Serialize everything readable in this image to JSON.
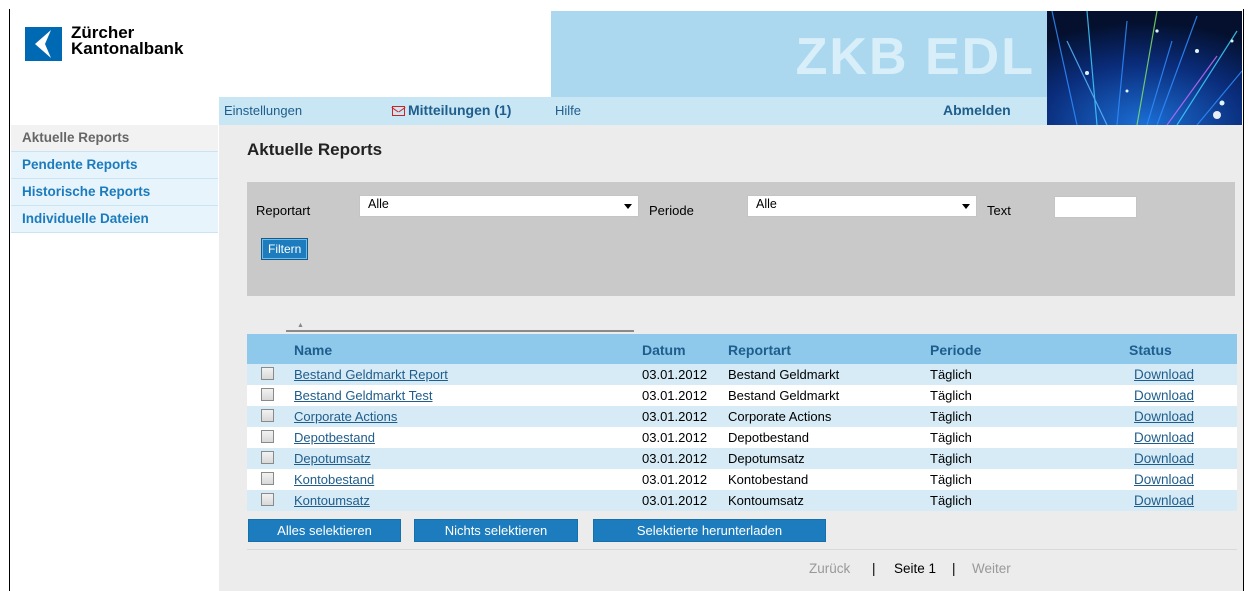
{
  "brand": {
    "name_line1": "Zürcher",
    "name_line2": "Kantonalbank",
    "banner_title": "ZKB EDL"
  },
  "topnav": {
    "settings": "Einstellungen",
    "messages": "Mitteilungen (1)",
    "help": "Hilfe",
    "logout": "Abmelden"
  },
  "sidebar": {
    "items": [
      {
        "label": "Aktuelle Reports",
        "active": true
      },
      {
        "label": "Pendente Reports"
      },
      {
        "label": "Historische Reports"
      },
      {
        "label": "Individuelle Dateien"
      }
    ]
  },
  "page": {
    "title": "Aktuelle Reports"
  },
  "filter": {
    "report_type_label": "Reportart",
    "report_type_value": "Alle",
    "period_label": "Periode",
    "period_value": "Alle",
    "text_label": "Text",
    "text_value": "",
    "button": "Filtern"
  },
  "table": {
    "headers": [
      "Name",
      "Datum",
      "Reportart",
      "Periode",
      "Status"
    ],
    "sort_indicator": "▲",
    "rows": [
      {
        "name": "Bestand Geldmarkt Report",
        "date": "03.01.2012",
        "type": "Bestand Geldmarkt",
        "period": "Täglich",
        "status": "Download"
      },
      {
        "name": "Bestand Geldmarkt Test",
        "date": "03.01.2012",
        "type": "Bestand Geldmarkt",
        "period": "Täglich",
        "status": "Download"
      },
      {
        "name": "Corporate Actions",
        "date": "03.01.2012",
        "type": "Corporate Actions",
        "period": "Täglich",
        "status": "Download"
      },
      {
        "name": "Depotbestand",
        "date": "03.01.2012",
        "type": "Depotbestand",
        "period": "Täglich",
        "status": "Download"
      },
      {
        "name": "Depotumsatz",
        "date": "03.01.2012",
        "type": "Depotumsatz",
        "period": "Täglich",
        "status": "Download"
      },
      {
        "name": "Kontobestand",
        "date": "03.01.2012",
        "type": "Kontobestand",
        "period": "Täglich",
        "status": "Download"
      },
      {
        "name": "Kontoumsatz",
        "date": "03.01.2012",
        "type": "Kontoumsatz",
        "period": "Täglich",
        "status": "Download"
      }
    ]
  },
  "actions": {
    "select_all": "Alles selektieren",
    "select_none": "Nichts selektieren",
    "download_selected": "Selektierte herunterladen"
  },
  "pager": {
    "prev": "Zurück",
    "sep": "|",
    "current": "Seite 1",
    "next": "Weiter"
  },
  "colors": {
    "accent": "#1c7cbd",
    "header_bg": "#8ec9ec",
    "banner": "#acd8ef",
    "row_alt": "#d6ebf6"
  }
}
